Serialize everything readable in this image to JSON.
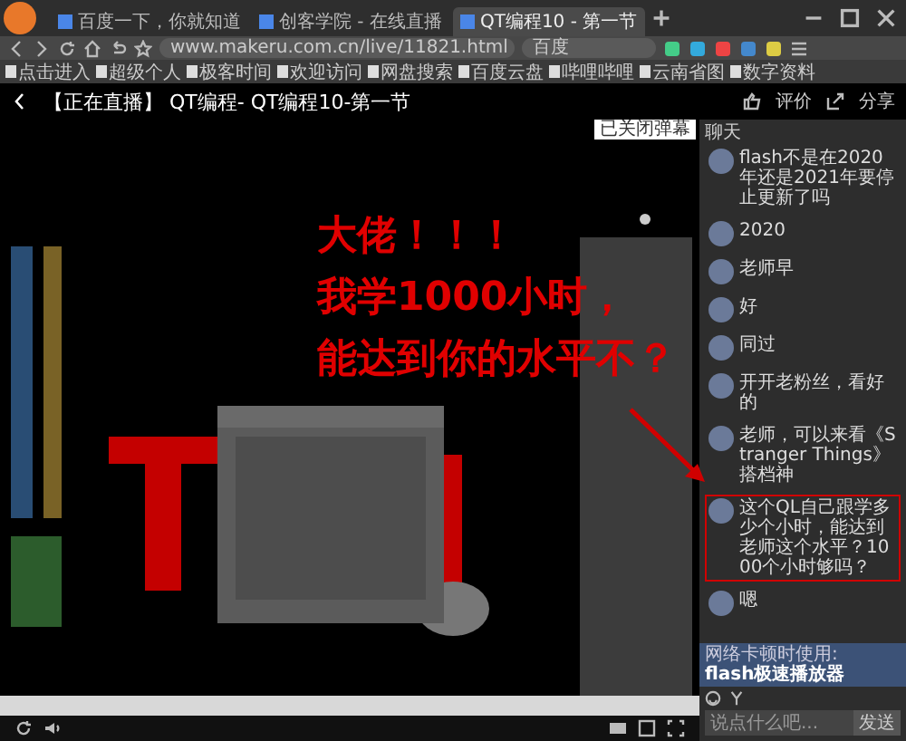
{
  "browser": {
    "tabs": [
      {
        "title": "百度一下，你就知道",
        "selected": false
      },
      {
        "title": "创客学院 - 在线直播",
        "selected": false
      },
      {
        "title": "QT编程10 - 第一节",
        "selected": true
      }
    ],
    "address": "www.makeru.com.cn/live/11821.html",
    "search_placeholder": "百度",
    "bookmarks": [
      "点击进入",
      "超级个人",
      "极客时间",
      "欢迎访问",
      "网盘搜索",
      "百度云盘",
      "哔哩哔哩",
      "云南省图",
      "数字资料"
    ]
  },
  "page": {
    "title": "【正在直播】 QT编程- QT编程10-第一节",
    "actions": [
      "评价",
      "分享"
    ]
  },
  "video": {
    "kind": "picture",
    "notice": "已关闭弹幕",
    "annotation": [
      "大佬！！！",
      "我学1000小时，",
      "能达到你的水平不？"
    ]
  },
  "chat": {
    "title": "聊天",
    "messages": [
      {
        "text": "flash不是在2020年还是2021年要停止更新了吗",
        "highlighted": false
      },
      {
        "text": "2020",
        "highlighted": false
      },
      {
        "text": "老师早",
        "highlighted": false
      },
      {
        "text": "好",
        "highlighted": false
      },
      {
        "text": "同过",
        "highlighted": false
      },
      {
        "text": "开开老粉丝，看好的",
        "highlighted": false
      },
      {
        "text": "老师，可以来看《Stranger Things》搭档神",
        "highlighted": false
      },
      {
        "text": "这个QL自己跟学多少个小时，能达到老师这个水平？1000个小时够吗？",
        "highlighted": true
      },
      {
        "text": "嗯",
        "highlighted": false
      }
    ],
    "notice_label": "网络卡顿时使用:",
    "notice_link": "flash极速播放器",
    "input_placeholder": "说点什么吧...",
    "send": "发送"
  }
}
